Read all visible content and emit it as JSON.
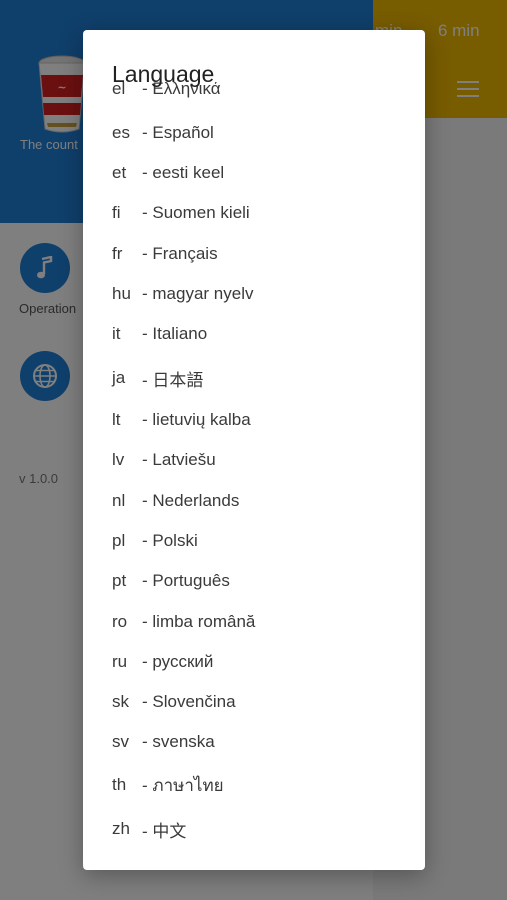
{
  "background": {
    "timer_cut": "min",
    "timer": "6 min",
    "drawer_description": "The count app.",
    "operation_label": "Operation",
    "version": "v 1.0.0",
    "colors": {
      "header_blue": "#1e7fd6",
      "topbar_yellow": "#f0b800"
    }
  },
  "dialog": {
    "title": "Language",
    "languages": [
      {
        "code": "el",
        "name": "- Ελληνικά"
      },
      {
        "code": "es",
        "name": "- Español"
      },
      {
        "code": "et",
        "name": "- eesti keel"
      },
      {
        "code": "fi",
        "name": "- Suomen kieli"
      },
      {
        "code": "fr",
        "name": "- Français"
      },
      {
        "code": "hu",
        "name": "- magyar nyelv"
      },
      {
        "code": "it",
        "name": "- Italiano"
      },
      {
        "code": "ja",
        "name": "- 日本語"
      },
      {
        "code": "lt",
        "name": "- lietuvių kalba"
      },
      {
        "code": "lv",
        "name": "- Latviešu"
      },
      {
        "code": "nl",
        "name": "- Nederlands"
      },
      {
        "code": "pl",
        "name": "- Polski"
      },
      {
        "code": "pt",
        "name": "- Português"
      },
      {
        "code": "ro",
        "name": "- limba română"
      },
      {
        "code": "ru",
        "name": "- русский"
      },
      {
        "code": "sk",
        "name": "- Slovenčina"
      },
      {
        "code": "sv",
        "name": "- svenska"
      },
      {
        "code": "th",
        "name": "- ภาษาไทย"
      },
      {
        "code": "zh",
        "name": "- 中文"
      }
    ]
  },
  "icons": [
    "cup-noodle-logo-icon",
    "music-note-icon",
    "globe-icon",
    "menu-icon"
  ]
}
